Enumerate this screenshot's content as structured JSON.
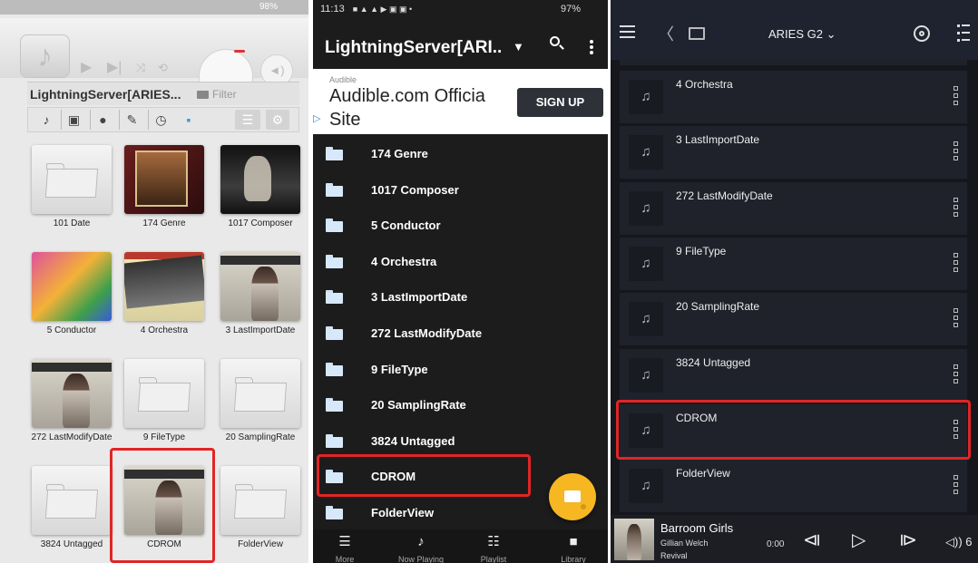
{
  "panel1": {
    "battery": "98%",
    "header_title": "LightningServer[ARIES...",
    "filter_label": "Filter",
    "tiles": [
      {
        "label": "101 Date",
        "art": "folder"
      },
      {
        "label": "174 Genre",
        "art": "genre"
      },
      {
        "label": "1017 Composer",
        "art": "composer"
      },
      {
        "label": "5 Conductor",
        "art": "conductor"
      },
      {
        "label": "4 Orchestra",
        "art": "orchestra"
      },
      {
        "label": "3 LastImportDate",
        "art": "welch"
      },
      {
        "label": "272 LastModifyDate",
        "art": "welch"
      },
      {
        "label": "9 FileType",
        "art": "folder"
      },
      {
        "label": "20 SamplingRate",
        "art": "folder"
      },
      {
        "label": "3824 Untagged",
        "art": "folder"
      },
      {
        "label": "CDROM",
        "art": "welch",
        "highlighted": true
      },
      {
        "label": "FolderView",
        "art": "folder"
      }
    ]
  },
  "panel2": {
    "status_time": "11:13",
    "status_battery": "97%",
    "title": "LightningServer[ARI..",
    "ad": {
      "small": "Audible",
      "headline": "Audible.com Officia",
      "site": "Site",
      "button": "SIGN UP"
    },
    "rows": [
      "174 Genre",
      "1017 Composer",
      "5 Conductor",
      "4 Orchestra",
      "3 LastImportDate",
      "272 LastModifyDate",
      "9 FileType",
      "20 SamplingRate",
      "3824 Untagged",
      "CDROM",
      "FolderView"
    ],
    "highlighted": "CDROM",
    "nav": [
      "More",
      "Now Playing",
      "Playlist",
      "Library"
    ]
  },
  "panel3": {
    "device": "ARIES G2",
    "rows": [
      "4 Orchestra",
      "3 LastImportDate",
      "272 LastModifyDate",
      "9 FileType",
      "20 SamplingRate",
      "3824 Untagged",
      "CDROM",
      "FolderView"
    ],
    "highlighted": "CDROM",
    "player": {
      "song": "Barroom Girls",
      "artist": "Gillian Welch",
      "album": "Revival",
      "time": "0:00",
      "volume": "6"
    }
  },
  "colors": {
    "highlight_red": "#e12525",
    "fab_yellow": "#f6b722",
    "panel2_bg": "#1c1c1c",
    "panel3_bg": "#1b1d25"
  }
}
